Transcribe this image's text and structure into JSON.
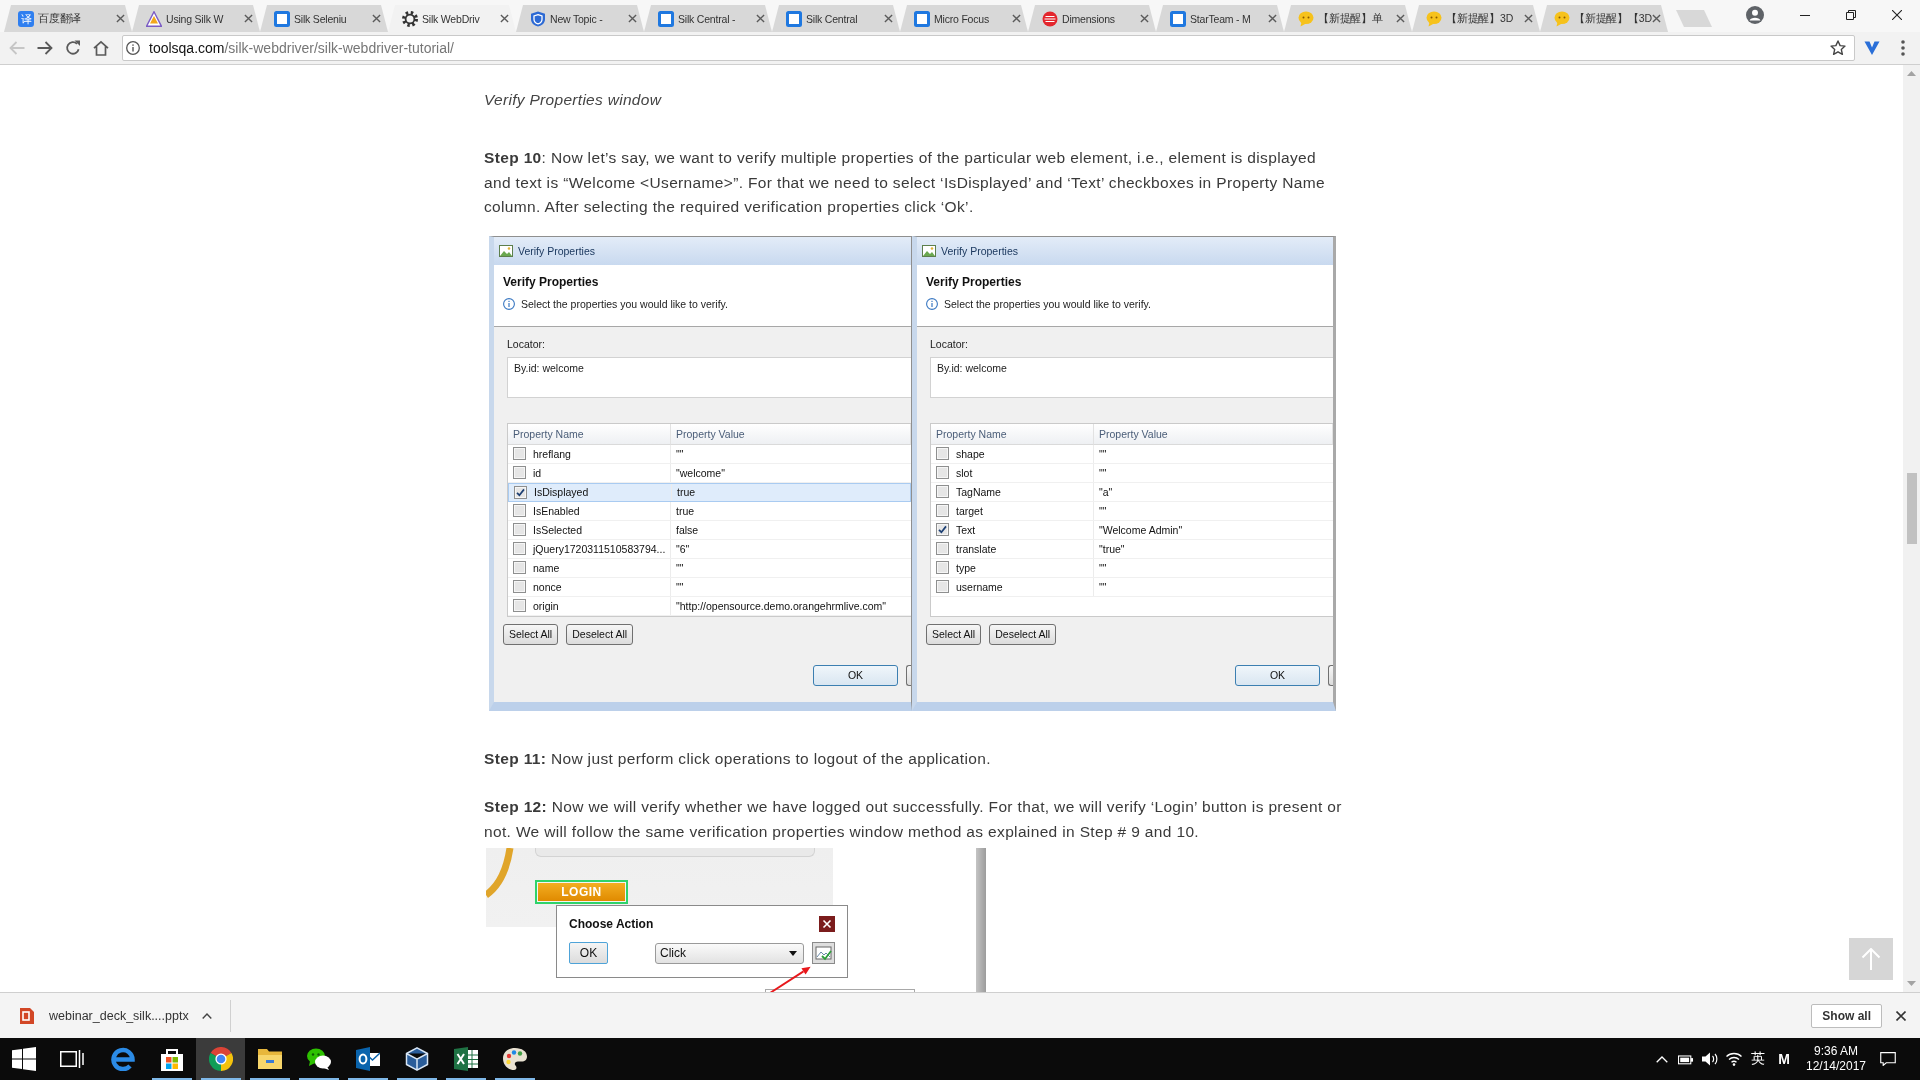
{
  "browser": {
    "tabs": [
      {
        "title": "百度翻译",
        "kind": "glyph",
        "icon_text": "译",
        "selected": false
      },
      {
        "title": "Using Silk W",
        "kind": "triangle",
        "selected": false
      },
      {
        "title": "Silk Seleniu",
        "kind": "square",
        "selected": false
      },
      {
        "title": "Silk WebDriv",
        "kind": "gear",
        "selected": true
      },
      {
        "title": "New Topic -",
        "kind": "shield",
        "selected": false
      },
      {
        "title": "Silk Central -",
        "kind": "square",
        "selected": false
      },
      {
        "title": "Silk Central",
        "kind": "square",
        "selected": false
      },
      {
        "title": "Micro Focus",
        "kind": "square",
        "selected": false
      },
      {
        "title": "Dimensions",
        "kind": "disc",
        "selected": false
      },
      {
        "title": "StarTeam - M",
        "kind": "square",
        "selected": false
      },
      {
        "title": "【新提醒】单",
        "kind": "bubble",
        "selected": false
      },
      {
        "title": "【新提醒】3D",
        "kind": "bubble",
        "selected": false
      },
      {
        "title": "【新提醒】【3D",
        "kind": "bubble",
        "selected": false
      }
    ],
    "toolbar": {
      "back_disabled": true,
      "url_host": "toolsqa.com",
      "url_path": "/silk-webdriver/silk-webdriver-tutorial/"
    }
  },
  "content": [
    {
      "kind": "caption",
      "text": "Verify Properties window"
    },
    {
      "kind": "paragraph",
      "text": "**Step 10**: Now let’s say, we want to verify multiple properties of the particular web element, i.e., element is displayed and text is “Welcome <Username>”. For that we need to select ‘IsDisplayed’ and ‘Text’ checkboxes in Property Name column. After selecting the required verification properties click ‘Ok’."
    },
    {
      "kind": "dialogs",
      "dialogs": [
        {
          "window_title": "Verify Properties",
          "heading": "Verify Properties",
          "hint": "Select the properties you would like to verify.",
          "locator_label": "Locator:",
          "locator": "By.id: welcome",
          "columns": [
            "Property Name",
            "Property Value"
          ],
          "rows": [
            {
              "name": "hreflang",
              "value": "\"\"",
              "checked": false,
              "selected": false
            },
            {
              "name": "id",
              "value": "\"welcome\"",
              "checked": false,
              "selected": false
            },
            {
              "name": "IsDisplayed",
              "value": "true",
              "checked": true,
              "selected": true
            },
            {
              "name": "IsEnabled",
              "value": "true",
              "checked": false,
              "selected": false
            },
            {
              "name": "IsSelected",
              "value": "false",
              "checked": false,
              "selected": false
            },
            {
              "name": "jQuery1720311510583794...",
              "value": "\"6\"",
              "checked": false,
              "selected": false
            },
            {
              "name": "name",
              "value": "\"\"",
              "checked": false,
              "selected": false
            },
            {
              "name": "nonce",
              "value": "\"\"",
              "checked": false,
              "selected": false
            },
            {
              "name": "origin",
              "value": "\"http://opensource.demo.orangehrmlive.com\"",
              "checked": false,
              "selected": false
            }
          ],
          "select_all": "Select All",
          "deselect_all": "Deselect All",
          "ok": "OK"
        },
        {
          "window_title": "Verify Properties",
          "heading": "Verify Properties",
          "hint": "Select the properties you would like to verify.",
          "locator_label": "Locator:",
          "locator": "By.id: welcome",
          "columns": [
            "Property Name",
            "Property Value"
          ],
          "rows": [
            {
              "name": "shape",
              "value": "\"\"",
              "checked": false,
              "selected": false
            },
            {
              "name": "slot",
              "value": "\"\"",
              "checked": false,
              "selected": false
            },
            {
              "name": "TagName",
              "value": "\"a\"",
              "checked": false,
              "selected": false
            },
            {
              "name": "target",
              "value": "\"\"",
              "checked": false,
              "selected": false
            },
            {
              "name": "Text",
              "value": "\"Welcome Admin\"",
              "checked": true,
              "selected": false
            },
            {
              "name": "translate",
              "value": "\"true\"",
              "checked": false,
              "selected": false
            },
            {
              "name": "type",
              "value": "\"\"",
              "checked": false,
              "selected": false
            },
            {
              "name": "username",
              "value": "\"\"",
              "checked": false,
              "selected": false
            }
          ],
          "select_all": "Select All",
          "deselect_all": "Deselect All",
          "ok": "OK"
        }
      ]
    },
    {
      "kind": "paragraph",
      "text": "**Step 11:** Now just perform click operations to logout of the application."
    },
    {
      "kind": "paragraph",
      "text": "**Step 12:** Now we will verify whether we have logged out successfully. For that, we will verify ‘Login’ button is present or not. We will follow the same verification properties window method as explained in Step # 9 and 10."
    },
    {
      "kind": "login_shot",
      "login_label": "LOGIN",
      "dialog_title": "Choose Action",
      "ok_label": "OK",
      "action": "Click"
    }
  ],
  "downloads": {
    "file": "webinar_deck_silk....pptx",
    "show_all": "Show all"
  },
  "taskbar": {
    "apps": [
      {
        "kind": "e",
        "running": false,
        "selected": false
      },
      {
        "kind": "bag",
        "running": true,
        "selected": false
      },
      {
        "kind": "wheel",
        "running": true,
        "selected": true
      },
      {
        "kind": "folder",
        "running": true,
        "selected": false
      },
      {
        "kind": "chat",
        "running": true,
        "selected": false
      },
      {
        "kind": "mail",
        "running": true,
        "selected": false
      },
      {
        "kind": "cube",
        "running": true,
        "selected": false
      },
      {
        "kind": "sheet",
        "running": true,
        "selected": false
      },
      {
        "kind": "palette",
        "running": true,
        "selected": false
      }
    ],
    "language": "英",
    "ime": "M",
    "time": "9:36 AM",
    "date": "12/14/2017"
  }
}
